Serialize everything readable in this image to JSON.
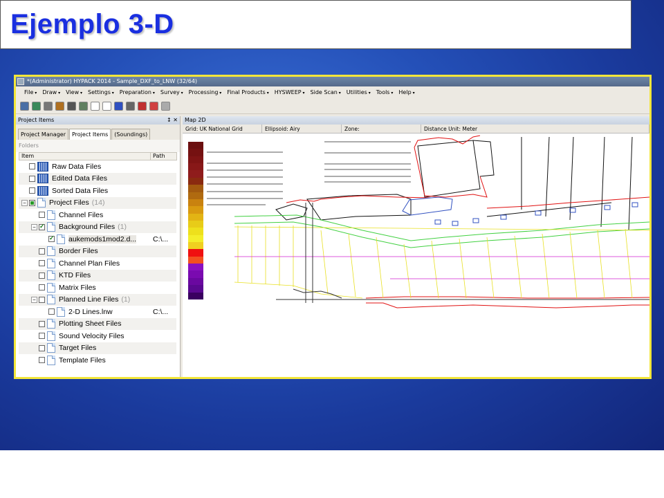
{
  "slide": {
    "title": "Ejemplo 3-D"
  },
  "app": {
    "window_title": "*(Administrator) HYPACK 2014 - Sample_DXF_to_LNW (32/64)",
    "menu": [
      "File",
      "Draw",
      "View",
      "Settings",
      "Preparation",
      "Survey",
      "Processing",
      "Final Products",
      "HYSWEEP",
      "Side Scan",
      "Utilities",
      "Tools",
      "Help"
    ],
    "toolbar_icons": [
      "save-icon",
      "globe-icon",
      "chart-icon",
      "pencil-icon",
      "line-icon",
      "survey-boat-icon",
      "document-icon",
      "book-icon",
      "graph-icon",
      "target-icon",
      "ruler-icon",
      "mountain-icon",
      "database-icon"
    ]
  },
  "left_pane": {
    "header": "Project Items",
    "header_buttons": "↕  ✕",
    "tabs": [
      "Project Manager",
      "Project Items",
      "(Soundings)"
    ],
    "active_tab": 1,
    "folders_label": "Folders",
    "columns": {
      "item": "Item",
      "path": "Path"
    },
    "rows": [
      {
        "label": "Raw Data Files",
        "count": "",
        "path": "",
        "level": 0,
        "icon": "grid",
        "check": "",
        "expander": ""
      },
      {
        "label": "Edited Data Files",
        "count": "",
        "path": "",
        "level": 0,
        "icon": "grid",
        "check": "",
        "expander": ""
      },
      {
        "label": "Sorted Data Files",
        "count": "",
        "path": "",
        "level": 0,
        "icon": "grid",
        "check": "",
        "expander": ""
      },
      {
        "label": "Project Files",
        "count": "(14)",
        "path": "",
        "level": 0,
        "icon": "doc",
        "check": "partial",
        "expander": "−"
      },
      {
        "label": "Channel Files",
        "count": "",
        "path": "",
        "level": 1,
        "icon": "doc",
        "check": "",
        "expander": ""
      },
      {
        "label": "Background Files",
        "count": "(1)",
        "path": "",
        "level": 1,
        "icon": "doc",
        "check": "checked",
        "expander": "−"
      },
      {
        "label": "aukemods1mod2.d...",
        "count": "",
        "path": "C:\\...",
        "level": 2,
        "icon": "doc",
        "check": "checked",
        "expander": "",
        "selected": true
      },
      {
        "label": "Border Files",
        "count": "",
        "path": "",
        "level": 1,
        "icon": "doc",
        "check": "",
        "expander": ""
      },
      {
        "label": "Channel Plan Files",
        "count": "",
        "path": "",
        "level": 1,
        "icon": "doc",
        "check": "",
        "expander": ""
      },
      {
        "label": "KTD Files",
        "count": "",
        "path": "",
        "level": 1,
        "icon": "doc",
        "check": "",
        "expander": ""
      },
      {
        "label": "Matrix Files",
        "count": "",
        "path": "",
        "level": 1,
        "icon": "doc",
        "check": "",
        "expander": ""
      },
      {
        "label": "Planned Line Files",
        "count": "(1)",
        "path": "",
        "level": 1,
        "icon": "doc",
        "check": "",
        "expander": "−"
      },
      {
        "label": "2-D Lines.lnw",
        "count": "",
        "path": "C:\\...",
        "level": 2,
        "icon": "doc",
        "check": "",
        "expander": ""
      },
      {
        "label": "Plotting Sheet Files",
        "count": "",
        "path": "",
        "level": 1,
        "icon": "doc",
        "check": "",
        "expander": ""
      },
      {
        "label": "Sound Velocity Files",
        "count": "",
        "path": "",
        "level": 1,
        "icon": "doc",
        "check": "",
        "expander": ""
      },
      {
        "label": "Target Files",
        "count": "",
        "path": "",
        "level": 1,
        "icon": "doc",
        "check": "",
        "expander": ""
      },
      {
        "label": "Template Files",
        "count": "",
        "path": "",
        "level": 1,
        "icon": "doc",
        "check": "",
        "expander": ""
      }
    ]
  },
  "map": {
    "tab": "Map 2D",
    "info": [
      "Grid: UK National Grid",
      "Ellipsoid: Airy",
      "Zone:",
      "Distance Unit: Meter"
    ],
    "legend_colors": [
      "#6b0f0f",
      "#751111",
      "#7f1414",
      "#881818",
      "#8f1c1c",
      "#8a2a10",
      "#a35a0f",
      "#b06a10",
      "#c9820f",
      "#d99a10",
      "#e3b414",
      "#e8cc18",
      "#eee01c",
      "#f4ee2a",
      "#f0d020",
      "#f01010",
      "#f35020",
      "#8a10c0",
      "#7a0ab0",
      "#6a08a0",
      "#5a0890",
      "#3a0060"
    ]
  }
}
